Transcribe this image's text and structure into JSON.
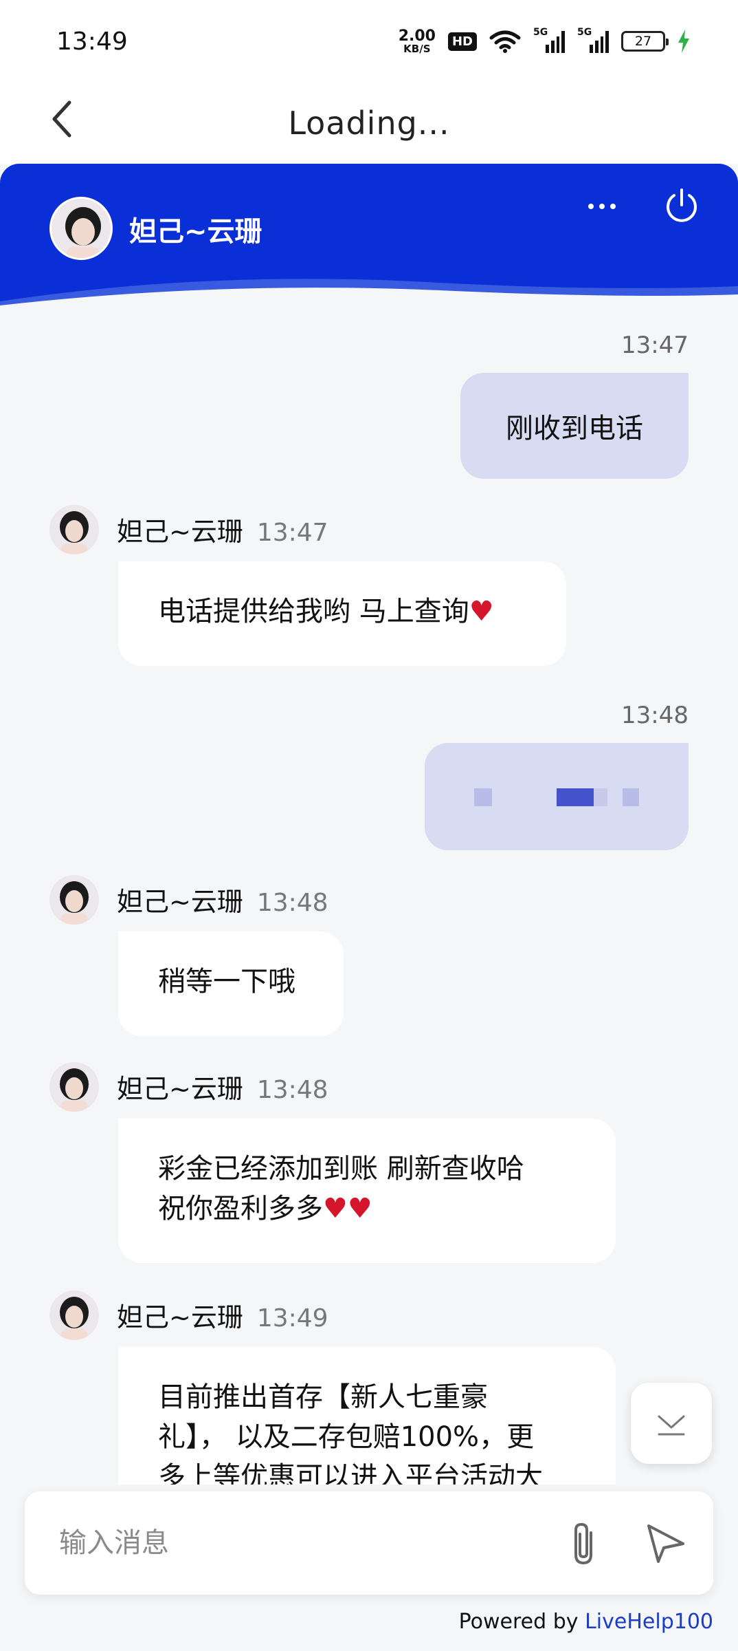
{
  "status_bar": {
    "time": "13:49",
    "net_speed_value": "2.00",
    "net_speed_unit": "KB/S",
    "hd_label": "HD",
    "signal1_label": "5G",
    "signal2_label": "5G",
    "battery": "27",
    "charging_color": "#2fb14a"
  },
  "nav": {
    "title": "Loading...",
    "back_icon": "chevron-left-icon"
  },
  "header": {
    "agent_name": "妲己~云珊",
    "more_icon": "more-horizontal-icon",
    "power_icon": "power-icon",
    "color": "#0a2fd6"
  },
  "messages": {
    "m1": {
      "time": "13:47",
      "text": "刚收到电话"
    },
    "m2": {
      "name": "妲己~云珊",
      "time": "13:47",
      "text": "电话提供给我哟 马上查询",
      "emoji": "♥"
    },
    "m3": {
      "time": "13:48"
    },
    "m4": {
      "name": "妲己~云珊",
      "time": "13:48",
      "text": "稍等一下哦"
    },
    "m5": {
      "name": "妲己~云珊",
      "time": "13:48",
      "line1": "彩金已经添加到账 刷新查收哈",
      "line2": "祝你盈利多多",
      "emoji": "♥"
    },
    "m6": {
      "name": "妲己~云珊",
      "time": "13:49",
      "line1": "目前推出首存【新人七重豪",
      "line2": "礼】， 以及二存包赔100%，更",
      "line3": "多上等优惠可以进入平台活动大"
    }
  },
  "composer": {
    "placeholder": "输入消息",
    "attach_icon": "paperclip-icon",
    "send_icon": "send-icon",
    "scroll_icon": "scroll-to-bottom-icon"
  },
  "footer": {
    "powered_by": "Powered by",
    "brand": "LiveHelp100"
  }
}
